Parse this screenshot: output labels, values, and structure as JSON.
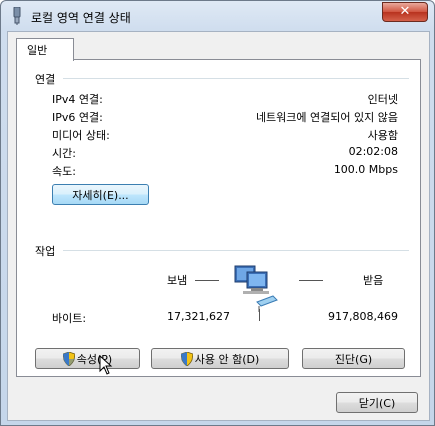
{
  "window": {
    "title": "로컬 영역 연결 상태",
    "close_glyph": "✕",
    "ok_label": "닫기(C)"
  },
  "tabs": [
    {
      "label": "일반"
    }
  ],
  "connection": {
    "heading": "연결",
    "rows": [
      {
        "label": "IPv4 연결:",
        "value": "인터넷"
      },
      {
        "label": "IPv6 연결:",
        "value": "네트워크에 연결되어 있지 않음"
      },
      {
        "label": "미디어 상태:",
        "value": "사용함"
      },
      {
        "label": "시간:",
        "value": "02:02:08"
      },
      {
        "label": "속도:",
        "value": "100.0 Mbps"
      }
    ],
    "details_label": "자세히(E)..."
  },
  "activity": {
    "heading": "작업",
    "sent_label": "보냄",
    "received_label": "받음",
    "bytes_label": "바이트:",
    "bytes_sent": "17,321,627",
    "bytes_received": "917,808,469",
    "icon": "network-computers-icon"
  },
  "actions": {
    "properties_label": "속성(P)",
    "disable_label": "사용 안 함(D)",
    "diagnose_label": "진단(G)"
  }
}
